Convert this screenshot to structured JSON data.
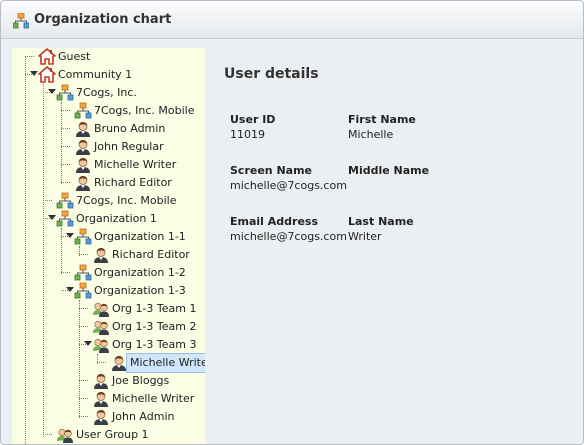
{
  "header": {
    "title": "Organization chart"
  },
  "tree": {
    "items": [
      {
        "label": "Guest",
        "icon": "home-icon"
      },
      {
        "label": "Community 1",
        "icon": "home-icon"
      },
      {
        "label": "7Cogs, Inc.",
        "icon": "org-icon"
      },
      {
        "label": "7Cogs, Inc. Mobile",
        "icon": "org-icon"
      },
      {
        "label": "Bruno Admin",
        "icon": "user-icon"
      },
      {
        "label": "John Regular",
        "icon": "user-icon"
      },
      {
        "label": "Michelle Writer",
        "icon": "user-icon"
      },
      {
        "label": "Richard Editor",
        "icon": "user-icon"
      },
      {
        "label": "7Cogs, Inc. Mobile",
        "icon": "org-icon"
      },
      {
        "label": "Organization 1",
        "icon": "org-icon"
      },
      {
        "label": "Organization 1-1",
        "icon": "org-icon"
      },
      {
        "label": "Richard Editor",
        "icon": "user-icon"
      },
      {
        "label": "Organization 1-2",
        "icon": "org-icon"
      },
      {
        "label": "Organization 1-3",
        "icon": "org-icon"
      },
      {
        "label": "Org 1-3 Team 1",
        "icon": "team-icon"
      },
      {
        "label": "Org 1-3 Team 2",
        "icon": "team-icon"
      },
      {
        "label": "Org 1-3 Team 3",
        "icon": "team-icon"
      },
      {
        "label": "Michelle Writer",
        "icon": "user-icon",
        "selected": true
      },
      {
        "label": "Joe Bloggs",
        "icon": "user-icon"
      },
      {
        "label": "Michelle Writer",
        "icon": "user-icon"
      },
      {
        "label": "John Admin",
        "icon": "user-icon"
      },
      {
        "label": "User Group 1",
        "icon": "team-icon"
      }
    ]
  },
  "details": {
    "heading": "User details",
    "user_id_label": "User ID",
    "user_id": "11019",
    "first_name_label": "First Name",
    "first_name": "Michelle",
    "screen_name_label": "Screen Name",
    "screen_name": "michelle@7cogs.com",
    "middle_name_label": "Middle Name",
    "middle_name": "",
    "email_label": "Email Address",
    "email": "michelle@7cogs.com",
    "last_name_label": "Last Name",
    "last_name": "Writer"
  },
  "colors": {
    "tree_background": "#fcfde5",
    "selection": "#cfe6fb",
    "panel_background": "#eceff2"
  }
}
